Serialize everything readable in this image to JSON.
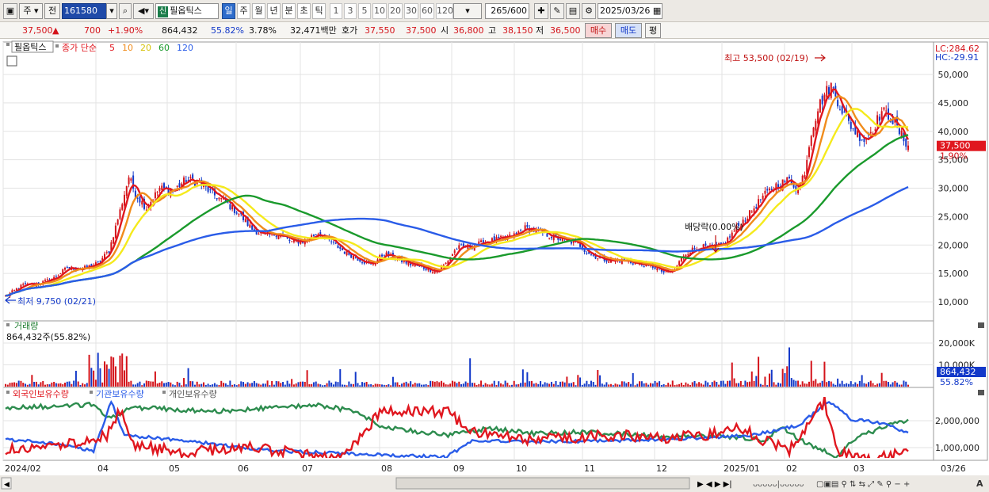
{
  "toolbar": {
    "period_type": "주",
    "market": "전",
    "stock_code": "161580",
    "stock_badge": "신",
    "stock_name": "필옵틱스",
    "periods": [
      {
        "label": "일",
        "active": true
      },
      {
        "label": "주",
        "active": false
      },
      {
        "label": "월",
        "active": false
      },
      {
        "label": "년",
        "active": false
      },
      {
        "label": "분",
        "active": false
      },
      {
        "label": "초",
        "active": false
      },
      {
        "label": "틱",
        "active": false
      }
    ],
    "intervals": [
      "1",
      "3",
      "5",
      "10",
      "20",
      "30",
      "60",
      "120"
    ],
    "count_value": "265",
    "count_max": "/600",
    "date": "2025/03/26"
  },
  "quote": {
    "price": "37,500",
    "change_arrow": "▲",
    "change": "700",
    "change_pct": "+1.90%",
    "volume": "864,432",
    "vol_ratio": "55.82%",
    "turnover": "3.78%",
    "amount": "32,471백만",
    "ask_label": "호가",
    "ask": "37,550",
    "bid": "37,500",
    "open_label": "시",
    "open": "36,800",
    "high_label": "고",
    "high": "38,150",
    "low_label": "저",
    "low": "36,500",
    "buy_label": "매수",
    "sell_label": "매도",
    "eval_label": "평"
  },
  "colors": {
    "up": "#d4131a",
    "down": "#1339c9",
    "ma5": "#e0171f",
    "ma10": "#f08c1c",
    "ma20": "#f5ea1c",
    "ma60": "#1a9a2c",
    "ma120": "#2a5ce8",
    "foreign": "#e0171f",
    "institution": "#2a5ce8",
    "individual": "#2d8c4e"
  },
  "chart_data": {
    "type": "candlestick",
    "price_panel": {
      "stock_label": "필옵틱스",
      "ma_legend_prefix": "종가 단순",
      "ma_periods": [
        "5",
        "10",
        "20",
        "60",
        "120"
      ],
      "lc_label": "LC:284.62",
      "hc_label": "HC:-29.91",
      "y_ticks": [
        "50,000",
        "45,000",
        "40,000",
        "35,000",
        "30,000",
        "25,000",
        "20,000",
        "15,000",
        "10,000"
      ],
      "ylim": [
        7000,
        55000
      ],
      "current_price_label": "37,500",
      "current_pct_label": "1.90%",
      "annotations": {
        "high": "최고 53,500 (02/19)",
        "low": "최저 9,750 (02/21)",
        "dividend": "배당락(0.00%)"
      },
      "close_anchors": [
        [
          0,
          11000
        ],
        [
          8,
          13000
        ],
        [
          15,
          13200
        ],
        [
          22,
          14200
        ],
        [
          28,
          16000
        ],
        [
          35,
          15800
        ],
        [
          42,
          16800
        ],
        [
          47,
          19000
        ],
        [
          52,
          26000
        ],
        [
          56,
          32000
        ],
        [
          59,
          29000
        ],
        [
          64,
          26500
        ],
        [
          70,
          30000
        ],
        [
          76,
          29500
        ],
        [
          82,
          31500
        ],
        [
          88,
          31000
        ],
        [
          94,
          29000
        ],
        [
          100,
          27500
        ],
        [
          106,
          25500
        ],
        [
          112,
          22800
        ],
        [
          118,
          21600
        ],
        [
          124,
          22000
        ],
        [
          130,
          20500
        ],
        [
          136,
          20800
        ],
        [
          142,
          22200
        ],
        [
          148,
          20500
        ],
        [
          154,
          18800
        ],
        [
          160,
          17600
        ],
        [
          166,
          16500
        ],
        [
          172,
          18500
        ],
        [
          178,
          17500
        ],
        [
          184,
          16600
        ],
        [
          190,
          16000
        ],
        [
          196,
          15300
        ],
        [
          200,
          16800
        ],
        [
          205,
          19500
        ],
        [
          212,
          19800
        ],
        [
          218,
          20600
        ],
        [
          224,
          21000
        ],
        [
          230,
          21500
        ],
        [
          236,
          23000
        ],
        [
          242,
          22400
        ],
        [
          248,
          21500
        ],
        [
          254,
          20800
        ],
        [
          260,
          20300
        ],
        [
          264,
          18800
        ],
        [
          270,
          17600
        ],
        [
          276,
          17300
        ],
        [
          282,
          17200
        ],
        [
          288,
          16600
        ],
        [
          294,
          16200
        ],
        [
          300,
          15000
        ],
        [
          304,
          15700
        ],
        [
          308,
          18300
        ],
        [
          312,
          19200
        ],
        [
          316,
          19700
        ],
        [
          320,
          19500
        ],
        [
          326,
          20000
        ],
        [
          332,
          23000
        ],
        [
          338,
          25500
        ],
        [
          344,
          28500
        ],
        [
          350,
          30500
        ],
        [
          356,
          31500
        ],
        [
          360,
          29800
        ],
        [
          363,
          33000
        ],
        [
          366,
          40000
        ],
        [
          369,
          44000
        ],
        [
          372,
          46500
        ],
        [
          375,
          48000
        ],
        [
          378,
          45500
        ],
        [
          382,
          42000
        ],
        [
          386,
          40000
        ],
        [
          390,
          38500
        ],
        [
          394,
          40500
        ],
        [
          398,
          43500
        ],
        [
          402,
          42500
        ],
        [
          406,
          39800
        ],
        [
          410,
          37500
        ]
      ],
      "total_bars": 411
    },
    "volume_panel": {
      "title": "거래량",
      "legend": "864,432주(55.82%)",
      "y_ticks": [
        "20,000K",
        "10,000K"
      ],
      "current_label": "864,432",
      "current_pct_label": "55.82%"
    },
    "holdings_panel": {
      "legend": [
        "외국인보유수량",
        "기관보유수량",
        "개인보유수량"
      ],
      "y_ticks": [
        "2,000,000",
        "1,000,000"
      ]
    },
    "x_ticks": [
      "2024/02",
      "04",
      "05",
      "06",
      "07",
      "08",
      "09",
      "10",
      "11",
      "12",
      "2025/01",
      "02",
      "03",
      "03/26"
    ]
  }
}
